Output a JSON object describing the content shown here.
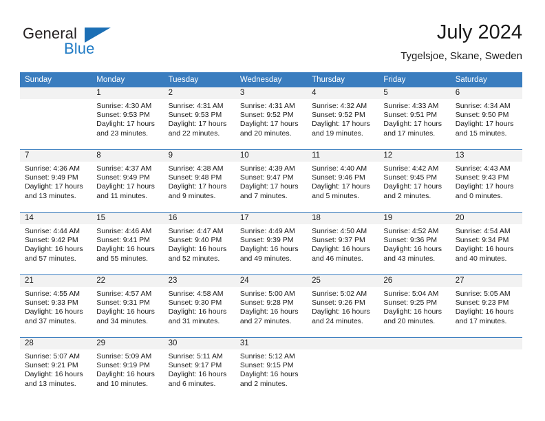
{
  "brand": {
    "name_part1": "General",
    "name_part2": "Blue",
    "flag_icon": "triangle-flag-icon",
    "accent_color": "#1c6fb5"
  },
  "header": {
    "title": "July 2024",
    "subtitle": "Tygelsjoe, Skane, Sweden"
  },
  "colors": {
    "header_blue": "#3a7dbf",
    "daynum_bg": "#f2f2f2",
    "text": "#1a1a1a"
  },
  "calendar": {
    "weekday_headers": [
      "Sunday",
      "Monday",
      "Tuesday",
      "Wednesday",
      "Thursday",
      "Friday",
      "Saturday"
    ],
    "weeks": [
      [
        {
          "day": "",
          "sunrise": "",
          "sunset": "",
          "daylight_line1": "",
          "daylight_line2": "",
          "empty": true
        },
        {
          "day": "1",
          "sunrise": "Sunrise: 4:30 AM",
          "sunset": "Sunset: 9:53 PM",
          "daylight_line1": "Daylight: 17 hours",
          "daylight_line2": "and 23 minutes."
        },
        {
          "day": "2",
          "sunrise": "Sunrise: 4:31 AM",
          "sunset": "Sunset: 9:53 PM",
          "daylight_line1": "Daylight: 17 hours",
          "daylight_line2": "and 22 minutes."
        },
        {
          "day": "3",
          "sunrise": "Sunrise: 4:31 AM",
          "sunset": "Sunset: 9:52 PM",
          "daylight_line1": "Daylight: 17 hours",
          "daylight_line2": "and 20 minutes."
        },
        {
          "day": "4",
          "sunrise": "Sunrise: 4:32 AM",
          "sunset": "Sunset: 9:52 PM",
          "daylight_line1": "Daylight: 17 hours",
          "daylight_line2": "and 19 minutes."
        },
        {
          "day": "5",
          "sunrise": "Sunrise: 4:33 AM",
          "sunset": "Sunset: 9:51 PM",
          "daylight_line1": "Daylight: 17 hours",
          "daylight_line2": "and 17 minutes."
        },
        {
          "day": "6",
          "sunrise": "Sunrise: 4:34 AM",
          "sunset": "Sunset: 9:50 PM",
          "daylight_line1": "Daylight: 17 hours",
          "daylight_line2": "and 15 minutes."
        }
      ],
      [
        {
          "day": "7",
          "sunrise": "Sunrise: 4:36 AM",
          "sunset": "Sunset: 9:49 PM",
          "daylight_line1": "Daylight: 17 hours",
          "daylight_line2": "and 13 minutes."
        },
        {
          "day": "8",
          "sunrise": "Sunrise: 4:37 AM",
          "sunset": "Sunset: 9:49 PM",
          "daylight_line1": "Daylight: 17 hours",
          "daylight_line2": "and 11 minutes."
        },
        {
          "day": "9",
          "sunrise": "Sunrise: 4:38 AM",
          "sunset": "Sunset: 9:48 PM",
          "daylight_line1": "Daylight: 17 hours",
          "daylight_line2": "and 9 minutes."
        },
        {
          "day": "10",
          "sunrise": "Sunrise: 4:39 AM",
          "sunset": "Sunset: 9:47 PM",
          "daylight_line1": "Daylight: 17 hours",
          "daylight_line2": "and 7 minutes."
        },
        {
          "day": "11",
          "sunrise": "Sunrise: 4:40 AM",
          "sunset": "Sunset: 9:46 PM",
          "daylight_line1": "Daylight: 17 hours",
          "daylight_line2": "and 5 minutes."
        },
        {
          "day": "12",
          "sunrise": "Sunrise: 4:42 AM",
          "sunset": "Sunset: 9:45 PM",
          "daylight_line1": "Daylight: 17 hours",
          "daylight_line2": "and 2 minutes."
        },
        {
          "day": "13",
          "sunrise": "Sunrise: 4:43 AM",
          "sunset": "Sunset: 9:43 PM",
          "daylight_line1": "Daylight: 17 hours",
          "daylight_line2": "and 0 minutes."
        }
      ],
      [
        {
          "day": "14",
          "sunrise": "Sunrise: 4:44 AM",
          "sunset": "Sunset: 9:42 PM",
          "daylight_line1": "Daylight: 16 hours",
          "daylight_line2": "and 57 minutes."
        },
        {
          "day": "15",
          "sunrise": "Sunrise: 4:46 AM",
          "sunset": "Sunset: 9:41 PM",
          "daylight_line1": "Daylight: 16 hours",
          "daylight_line2": "and 55 minutes."
        },
        {
          "day": "16",
          "sunrise": "Sunrise: 4:47 AM",
          "sunset": "Sunset: 9:40 PM",
          "daylight_line1": "Daylight: 16 hours",
          "daylight_line2": "and 52 minutes."
        },
        {
          "day": "17",
          "sunrise": "Sunrise: 4:49 AM",
          "sunset": "Sunset: 9:39 PM",
          "daylight_line1": "Daylight: 16 hours",
          "daylight_line2": "and 49 minutes."
        },
        {
          "day": "18",
          "sunrise": "Sunrise: 4:50 AM",
          "sunset": "Sunset: 9:37 PM",
          "daylight_line1": "Daylight: 16 hours",
          "daylight_line2": "and 46 minutes."
        },
        {
          "day": "19",
          "sunrise": "Sunrise: 4:52 AM",
          "sunset": "Sunset: 9:36 PM",
          "daylight_line1": "Daylight: 16 hours",
          "daylight_line2": "and 43 minutes."
        },
        {
          "day": "20",
          "sunrise": "Sunrise: 4:54 AM",
          "sunset": "Sunset: 9:34 PM",
          "daylight_line1": "Daylight: 16 hours",
          "daylight_line2": "and 40 minutes."
        }
      ],
      [
        {
          "day": "21",
          "sunrise": "Sunrise: 4:55 AM",
          "sunset": "Sunset: 9:33 PM",
          "daylight_line1": "Daylight: 16 hours",
          "daylight_line2": "and 37 minutes."
        },
        {
          "day": "22",
          "sunrise": "Sunrise: 4:57 AM",
          "sunset": "Sunset: 9:31 PM",
          "daylight_line1": "Daylight: 16 hours",
          "daylight_line2": "and 34 minutes."
        },
        {
          "day": "23",
          "sunrise": "Sunrise: 4:58 AM",
          "sunset": "Sunset: 9:30 PM",
          "daylight_line1": "Daylight: 16 hours",
          "daylight_line2": "and 31 minutes."
        },
        {
          "day": "24",
          "sunrise": "Sunrise: 5:00 AM",
          "sunset": "Sunset: 9:28 PM",
          "daylight_line1": "Daylight: 16 hours",
          "daylight_line2": "and 27 minutes."
        },
        {
          "day": "25",
          "sunrise": "Sunrise: 5:02 AM",
          "sunset": "Sunset: 9:26 PM",
          "daylight_line1": "Daylight: 16 hours",
          "daylight_line2": "and 24 minutes."
        },
        {
          "day": "26",
          "sunrise": "Sunrise: 5:04 AM",
          "sunset": "Sunset: 9:25 PM",
          "daylight_line1": "Daylight: 16 hours",
          "daylight_line2": "and 20 minutes."
        },
        {
          "day": "27",
          "sunrise": "Sunrise: 5:05 AM",
          "sunset": "Sunset: 9:23 PM",
          "daylight_line1": "Daylight: 16 hours",
          "daylight_line2": "and 17 minutes."
        }
      ],
      [
        {
          "day": "28",
          "sunrise": "Sunrise: 5:07 AM",
          "sunset": "Sunset: 9:21 PM",
          "daylight_line1": "Daylight: 16 hours",
          "daylight_line2": "and 13 minutes."
        },
        {
          "day": "29",
          "sunrise": "Sunrise: 5:09 AM",
          "sunset": "Sunset: 9:19 PM",
          "daylight_line1": "Daylight: 16 hours",
          "daylight_line2": "and 10 minutes."
        },
        {
          "day": "30",
          "sunrise": "Sunrise: 5:11 AM",
          "sunset": "Sunset: 9:17 PM",
          "daylight_line1": "Daylight: 16 hours",
          "daylight_line2": "and 6 minutes."
        },
        {
          "day": "31",
          "sunrise": "Sunrise: 5:12 AM",
          "sunset": "Sunset: 9:15 PM",
          "daylight_line1": "Daylight: 16 hours",
          "daylight_line2": "and 2 minutes."
        },
        {
          "day": "",
          "sunrise": "",
          "sunset": "",
          "daylight_line1": "",
          "daylight_line2": "",
          "empty": true
        },
        {
          "day": "",
          "sunrise": "",
          "sunset": "",
          "daylight_line1": "",
          "daylight_line2": "",
          "empty": true
        },
        {
          "day": "",
          "sunrise": "",
          "sunset": "",
          "daylight_line1": "",
          "daylight_line2": "",
          "empty": true
        }
      ]
    ]
  }
}
